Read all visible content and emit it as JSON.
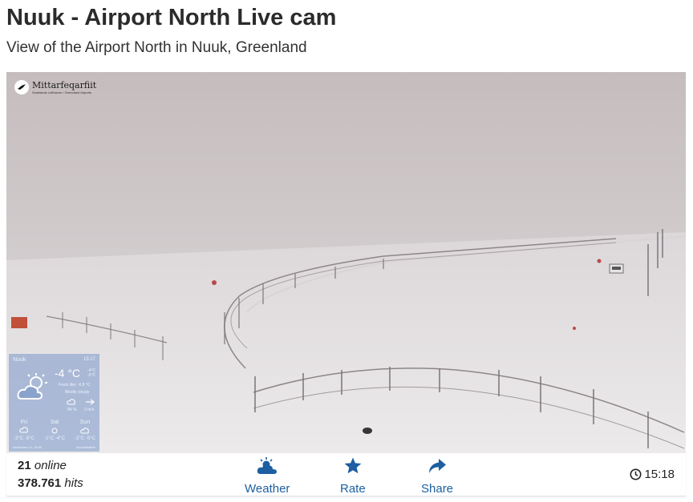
{
  "page": {
    "title": "Nuuk - Airport North Live cam",
    "subtitle": "View of the Airport North in Nuuk, Greenland"
  },
  "camera": {
    "logo_name": "Mittarfeqarfiit",
    "logo_tagline": "Grønlands Lufthavne / Greenland Airports"
  },
  "weather_widget": {
    "location": "Nuuk",
    "time": "15:17",
    "temperature": "-4 °C",
    "high": "-4°C",
    "low": "-5°C",
    "feels_like": "Feels like: -6.8 °C",
    "condition": "Mostly cloudy",
    "humidity": "84 %",
    "wind": "2 m/s",
    "forecast": [
      {
        "day": "Fri",
        "temps": "-3°C -5°C"
      },
      {
        "day": "Sat",
        "temps": "-1°C -4°C"
      },
      {
        "day": "Sun",
        "temps": "-2°C -5°C"
      }
    ],
    "updated": "November 14, 15:30",
    "brand": "AccuWeather"
  },
  "stats": {
    "online_count": "21",
    "online_label": "online",
    "hits_count": "378.761",
    "hits_label": "hits"
  },
  "actions": {
    "weather": "Weather",
    "rate": "Rate",
    "share": "Share"
  },
  "clock": {
    "time": "15:18"
  },
  "colors": {
    "accent": "#1d5fa0",
    "sky": "#c6bfc1",
    "snow": "#e4e0e2"
  }
}
